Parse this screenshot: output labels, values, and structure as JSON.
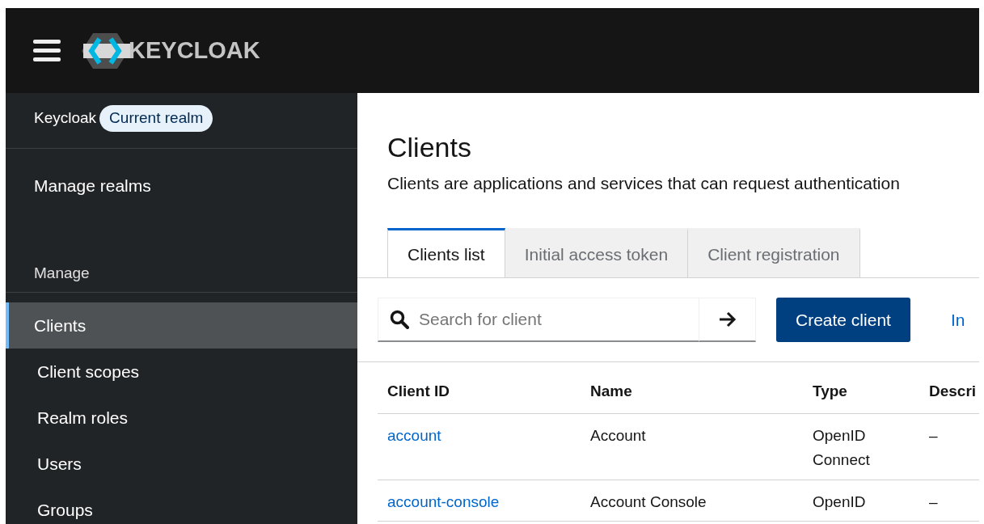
{
  "masthead": {
    "logo_text": "KEYCLOAK"
  },
  "sidebar": {
    "realm": {
      "name": "Keycloak",
      "badge": "Current realm"
    },
    "manage_realms": "Manage realms",
    "section": "Manage",
    "items": [
      {
        "label": "Clients",
        "selected": true
      },
      {
        "label": "Client scopes",
        "selected": false
      },
      {
        "label": "Realm roles",
        "selected": false
      },
      {
        "label": "Users",
        "selected": false
      },
      {
        "label": "Groups",
        "selected": false
      }
    ]
  },
  "page": {
    "title": "Clients",
    "description": "Clients are applications and services that can request authentication"
  },
  "tabs": [
    {
      "label": "Clients list",
      "selected": true
    },
    {
      "label": "Initial access token",
      "selected": false
    },
    {
      "label": "Client registration",
      "selected": false
    }
  ],
  "toolbar": {
    "search": {
      "placeholder": "Search for client"
    },
    "primary_button": "Create client",
    "link": "In"
  },
  "table": {
    "columns": [
      "Client ID",
      "Name",
      "Type",
      "Descri"
    ],
    "rows": [
      [
        "account",
        "Account",
        "OpenID Connect",
        "–"
      ],
      [
        "account-console",
        "Account Console",
        "OpenID",
        "–"
      ]
    ]
  }
}
